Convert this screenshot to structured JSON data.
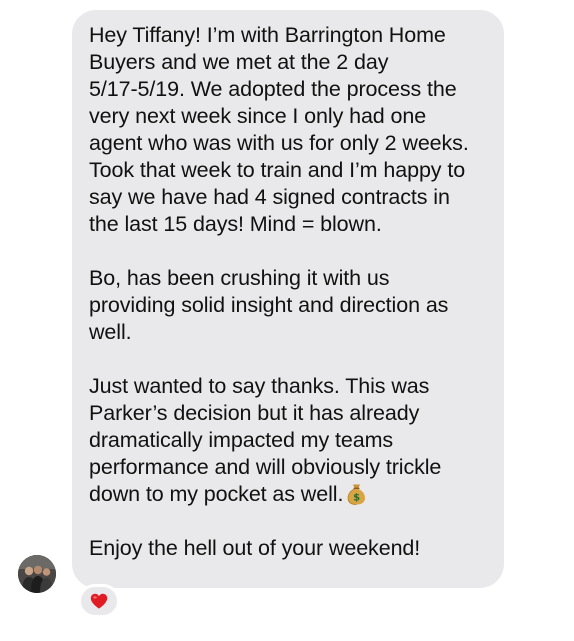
{
  "message": {
    "paragraphs": [
      "Hey Tiffany! I’m with Barrington Home\nBuyers and we met at the 2 day\n5/17-5/19. We adopted the process the\nvery next week since I only had one\nagent who was with us for only 2 weeks.\nTook that week to train and I’m happy to\nsay we have had 4 signed contracts in\nthe last 15 days! Mind = blown.",
      "Bo, has been crushing it with us\nproviding solid insight and direction as\nwell.",
      "Just wanted to say thanks. This was\nParker’s decision but it has already\ndramatically impacted my teams\nperformance and will obviously trickle\ndown to my pocket as well.",
      "Enjoy the hell out of your weekend!"
    ],
    "inline_icon": "money-bag-icon"
  },
  "sender": {
    "avatar_icon": "group-photo-avatar"
  },
  "reaction": {
    "icon": "heart-icon",
    "color": "#e01b24"
  },
  "colors": {
    "bubble": "#e9e9eb",
    "text": "#111111",
    "background": "#ffffff"
  }
}
